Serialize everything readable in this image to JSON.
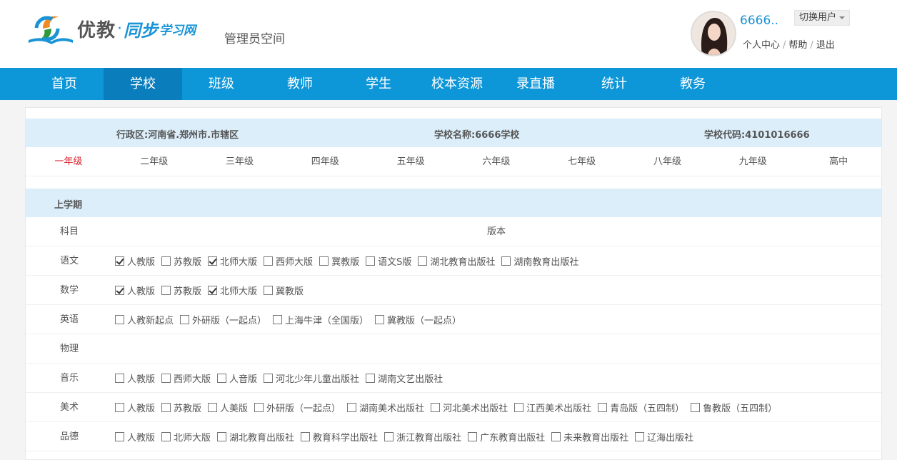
{
  "brand": {
    "name1": "优教",
    "dot": "·",
    "name2": "同步",
    "name3": "学习网",
    "admin_label": "管理员空间"
  },
  "user": {
    "name": "6666..",
    "switch_label": "切换用户",
    "links": [
      "个人中心",
      "帮助",
      "退出"
    ]
  },
  "nav": {
    "items": [
      "首页",
      "学校",
      "班级",
      "教师",
      "学生",
      "校本资源",
      "录直播",
      "统计",
      "教务"
    ],
    "active": "学校"
  },
  "school": {
    "district": "行政区:河南省.郑州市.市辖区",
    "name": "学校名称:6666学校",
    "code": "学校代码:4101016666"
  },
  "grades": [
    "一年级",
    "二年级",
    "三年级",
    "四年级",
    "五年级",
    "六年级",
    "七年级",
    "八年级",
    "九年级",
    "高中"
  ],
  "active_grade": "一年级",
  "term": "上学期",
  "table_header": {
    "subject": "科目",
    "version": "版本"
  },
  "subjects": [
    {
      "name": "语文",
      "options": [
        {
          "label": "人教版",
          "checked": true
        },
        {
          "label": "苏教版",
          "checked": false
        },
        {
          "label": "北师大版",
          "checked": true
        },
        {
          "label": "西师大版",
          "checked": false
        },
        {
          "label": "冀教版",
          "checked": false
        },
        {
          "label": "语文S版",
          "checked": false
        },
        {
          "label": "湖北教育出版社",
          "checked": false
        },
        {
          "label": "湖南教育出版社",
          "checked": false
        }
      ]
    },
    {
      "name": "数学",
      "options": [
        {
          "label": "人教版",
          "checked": true
        },
        {
          "label": "苏教版",
          "checked": false
        },
        {
          "label": "北师大版",
          "checked": true
        },
        {
          "label": "冀教版",
          "checked": false
        }
      ]
    },
    {
      "name": "英语",
      "options": [
        {
          "label": "人教新起点",
          "checked": false
        },
        {
          "label": "外研版（一起点）",
          "checked": false
        },
        {
          "label": "上海牛津（全国版）",
          "checked": false
        },
        {
          "label": "冀教版（一起点）",
          "checked": false
        }
      ]
    },
    {
      "name": "物理",
      "options": []
    },
    {
      "name": "音乐",
      "options": [
        {
          "label": "人教版",
          "checked": false
        },
        {
          "label": "西师大版",
          "checked": false
        },
        {
          "label": "人音版",
          "checked": false
        },
        {
          "label": "河北少年儿童出版社",
          "checked": false
        },
        {
          "label": "湖南文艺出版社",
          "checked": false
        }
      ]
    },
    {
      "name": "美术",
      "options": [
        {
          "label": "人教版",
          "checked": false
        },
        {
          "label": "苏教版",
          "checked": false
        },
        {
          "label": "人美版",
          "checked": false
        },
        {
          "label": "外研版（一起点）",
          "checked": false
        },
        {
          "label": "湖南美术出版社",
          "checked": false
        },
        {
          "label": "河北美术出版社",
          "checked": false
        },
        {
          "label": "江西美术出版社",
          "checked": false
        },
        {
          "label": "青岛版（五四制）",
          "checked": false
        },
        {
          "label": "鲁教版（五四制）",
          "checked": false
        }
      ]
    },
    {
      "name": "品德",
      "options": [
        {
          "label": "人教版",
          "checked": false
        },
        {
          "label": "北师大版",
          "checked": false
        },
        {
          "label": "湖北教育出版社",
          "checked": false
        },
        {
          "label": "教育科学出版社",
          "checked": false
        },
        {
          "label": "浙江教育出版社",
          "checked": false
        },
        {
          "label": "广东教育出版社",
          "checked": false
        },
        {
          "label": "未来教育出版社",
          "checked": false
        },
        {
          "label": "辽海出版社",
          "checked": false
        }
      ]
    }
  ]
}
